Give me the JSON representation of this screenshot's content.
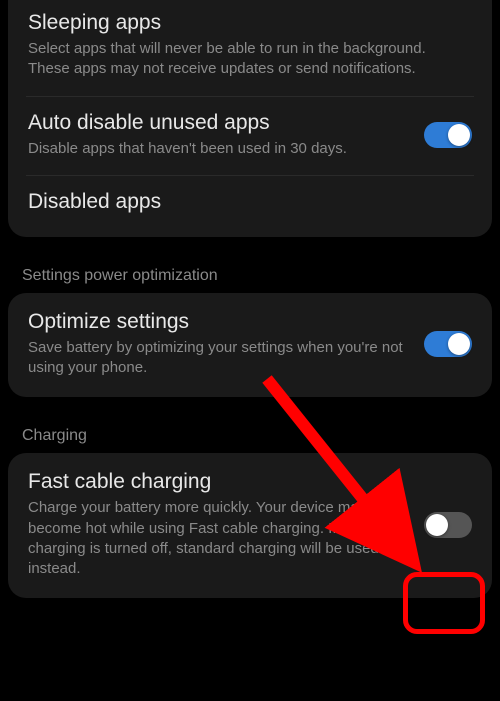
{
  "panel1": {
    "sleeping": {
      "title": "Sleeping apps",
      "desc": "Select apps that will never be able to run in the background. These apps may not receive updates or send notifications."
    },
    "autoDisable": {
      "title": "Auto disable unused apps",
      "desc": "Disable apps that haven't been used in 30 days.",
      "toggle": true
    },
    "disabled": {
      "title": "Disabled apps"
    }
  },
  "section2": {
    "header": "Settings power optimization",
    "optimize": {
      "title": "Optimize settings",
      "desc": "Save battery by optimizing your settings when you're not using your phone.",
      "toggle": true
    }
  },
  "section3": {
    "header": "Charging",
    "fastCharge": {
      "title": "Fast cable charging",
      "desc": "Charge your battery more quickly. Your device may become hot while using Fast cable charging. If Fast cable charging is turned off, standard charging will be used instead.",
      "toggle": false
    }
  },
  "annotation": {
    "highlightColor": "#ff0000"
  }
}
